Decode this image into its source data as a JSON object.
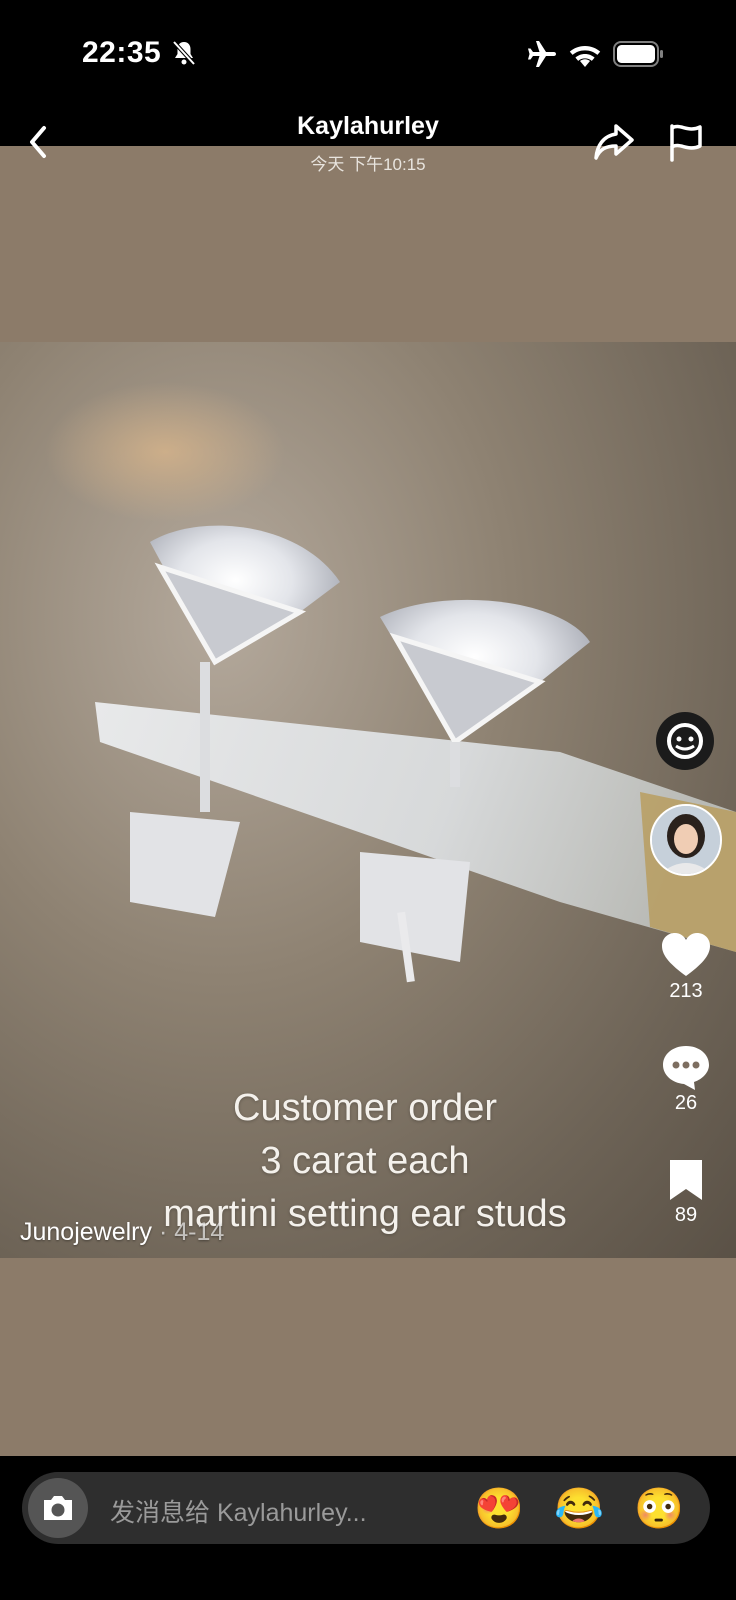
{
  "status_bar": {
    "time": "22:35",
    "icons": [
      "bell-slash-icon",
      "airplane-icon",
      "wifi-icon",
      "battery-icon"
    ]
  },
  "header": {
    "title": "Kaylahurley",
    "subtitle": "今天 下午10:15",
    "icons": [
      "chevron-left-icon",
      "share-arrow-icon",
      "flag-icon"
    ]
  },
  "post": {
    "caption_lines": [
      "Customer order",
      "3 carat each",
      "martini setting ear studs"
    ],
    "author": "Junojewelry",
    "date": " · 4-14"
  },
  "actions": {
    "likes": "213",
    "comments": "26",
    "saves": "89"
  },
  "composer": {
    "placeholder": "发消息给 Kaylahurley...",
    "emojis": [
      "😍",
      "😂",
      "😳"
    ]
  },
  "colors": {
    "media_background": "#8c7b69",
    "bar_background": "#000000",
    "input_background": "#2e2e2e"
  }
}
